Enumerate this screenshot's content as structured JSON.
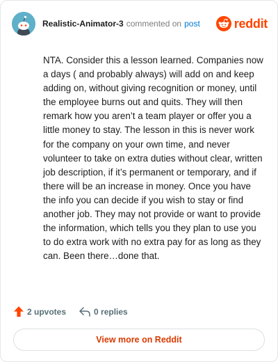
{
  "header": {
    "username": "Realistic-Animator-3",
    "action_text": "commented on",
    "post_link": "post",
    "brand": "reddit"
  },
  "comment": {
    "text": "NTA. Consider this a lesson learned. Companies now a days ( and probably always) will add on and keep adding on, without giving recognition or money, until the employee burns out and quits. They will then remark how you aren’t a team player or offer you a little money to stay. The lesson in this is never work for the company on your own time, and never volunteer to take on extra duties without clear, written job description, if it’s permanent or temporary, and if there will be an increase in money. Once you have the info you can decide if you wish to stay or find another job. They may not provide or want to provide the information, which tells you they plan to use you to do extra work with no extra pay for as long as they can. Been there…done that."
  },
  "footer": {
    "upvotes": "2 upvotes",
    "replies": "0 replies",
    "view_more": "View more on Reddit"
  },
  "colors": {
    "brand": "#ff4500",
    "link": "#0079d3",
    "upvote": "#ff4500",
    "view_more_text": "#d93a00",
    "avatar_bg": "#5fb0c9"
  },
  "icons": {
    "avatar": "snoo-avatar-icon",
    "brand_logo": "reddit-snoo-icon",
    "upvote": "upvote-arrow-icon",
    "reply": "reply-arrow-icon"
  }
}
